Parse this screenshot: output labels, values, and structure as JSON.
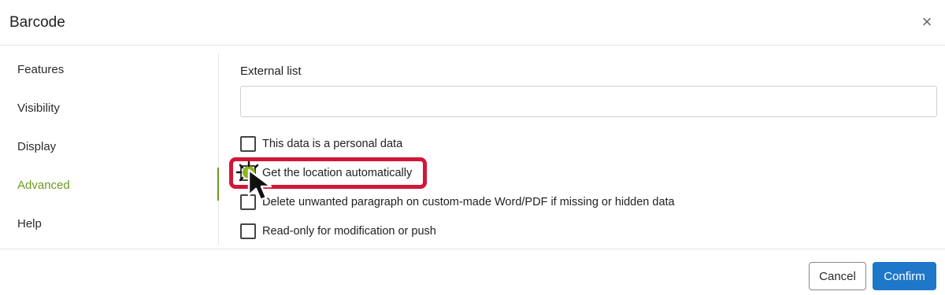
{
  "dialog": {
    "title": "Barcode",
    "close_label": "×"
  },
  "sidebar": {
    "items": [
      {
        "label": "Features"
      },
      {
        "label": "Visibility"
      },
      {
        "label": "Display"
      },
      {
        "label": "Advanced",
        "active": true
      },
      {
        "label": "Help"
      }
    ]
  },
  "content": {
    "external_list": {
      "label": "External list",
      "value": "",
      "placeholder": ""
    },
    "checkboxes": [
      {
        "label": "This data is a personal data",
        "checked": false
      },
      {
        "label": "Get the location automatically",
        "checked": false,
        "highlighted": true
      },
      {
        "label": "Delete unwanted paragraph on custom-made Word/PDF if missing or hidden data",
        "checked": false
      },
      {
        "label": "Read-only for modification or push",
        "checked": false
      }
    ]
  },
  "footer": {
    "cancel_label": "Cancel",
    "confirm_label": "Confirm"
  },
  "colors": {
    "accent_green": "#6a9b1e",
    "confirm_blue": "#1f77c9",
    "highlight_red": "#d0173a"
  },
  "icons": {
    "close": "close-icon",
    "cursor": "mouse-pointer-icon"
  }
}
